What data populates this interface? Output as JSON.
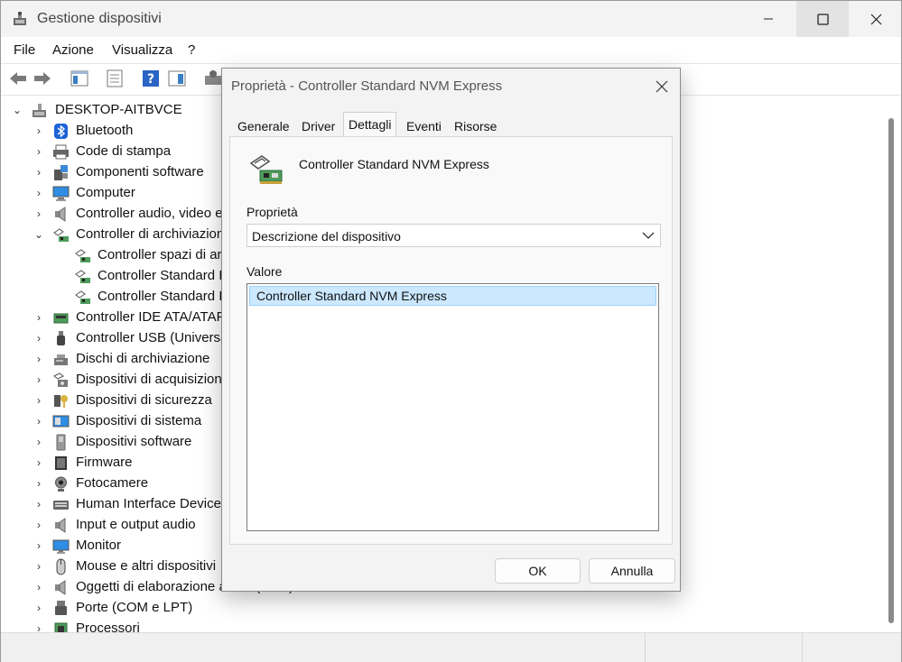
{
  "window": {
    "title": "Gestione dispositivi"
  },
  "menu": [
    "File",
    "Azione",
    "Visualizza",
    "?"
  ],
  "tree": {
    "root": "DESKTOP-AITBVCE",
    "items": [
      {
        "label": "Bluetooth",
        "icon": "bluetooth-icon"
      },
      {
        "label": "Code di stampa",
        "icon": "printer-icon"
      },
      {
        "label": "Componenti software",
        "icon": "software-component-icon"
      },
      {
        "label": "Computer",
        "icon": "computer-icon"
      },
      {
        "label": "Controller audio, video e",
        "icon": "speaker-icon"
      },
      {
        "label": "Controller di archiviazion",
        "icon": "storage-controller-icon",
        "expanded": true
      },
      {
        "label": "Controller spazi di ar",
        "icon": "storage-controller-icon",
        "child": true
      },
      {
        "label": "Controller Standard I",
        "icon": "storage-controller-icon",
        "child": true
      },
      {
        "label": "Controller Standard I",
        "icon": "storage-controller-icon",
        "child": true
      },
      {
        "label": "Controller IDE ATA/ATAPI",
        "icon": "ide-controller-icon"
      },
      {
        "label": "Controller USB (Universa",
        "icon": "usb-icon"
      },
      {
        "label": "Dischi di archiviazione",
        "icon": "disk-icon"
      },
      {
        "label": "Dispositivi di acquisizion",
        "icon": "camera-device-icon"
      },
      {
        "label": "Dispositivi di sicurezza",
        "icon": "key-icon"
      },
      {
        "label": "Dispositivi di sistema",
        "icon": "system-device-icon"
      },
      {
        "label": "Dispositivi software",
        "icon": "software-device-icon"
      },
      {
        "label": "Firmware",
        "icon": "firmware-icon"
      },
      {
        "label": "Fotocamere",
        "icon": "webcam-icon"
      },
      {
        "label": "Human Interface Device",
        "icon": "keyboard-icon"
      },
      {
        "label": "Input e output audio",
        "icon": "speaker-icon"
      },
      {
        "label": "Monitor",
        "icon": "monitor-icon"
      },
      {
        "label": "Mouse e altri dispositivi",
        "icon": "mouse-icon"
      },
      {
        "label": "Oggetti di elaborazione audio (APO)",
        "icon": "speaker-icon"
      },
      {
        "label": "Porte (COM e LPT)",
        "icon": "port-icon"
      },
      {
        "label": "Processori",
        "icon": "processor-icon"
      }
    ]
  },
  "dialog": {
    "title": "Proprietà - Controller Standard NVM Express",
    "tabs": [
      "Generale",
      "Driver",
      "Dettagli",
      "Eventi",
      "Risorse"
    ],
    "active_tab": "Dettagli",
    "device_name": "Controller Standard NVM Express",
    "property_label": "Proprietà",
    "property_value": "Descrizione del dispositivo",
    "value_label": "Valore",
    "value_item": "Controller Standard NVM Express",
    "ok": "OK",
    "cancel": "Annulla"
  }
}
